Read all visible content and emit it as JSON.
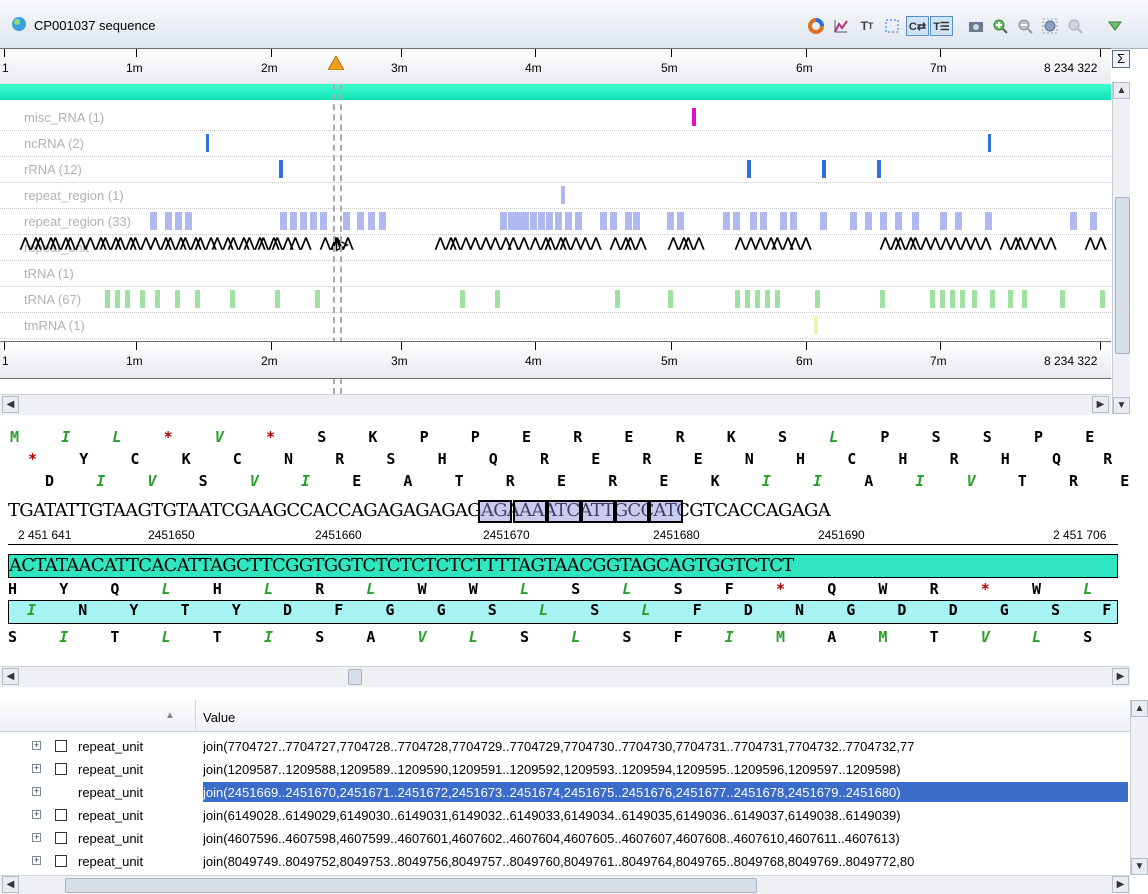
{
  "window": {
    "title": "CP001037 sequence"
  },
  "toolbar": {
    "icons": [
      "color-wheel-icon",
      "chart-icon",
      "font-size-icon",
      "select-region-icon",
      "sync-icon",
      "text-toggle-icon",
      "camera-icon",
      "zoom-in-icon",
      "zoom-out-icon",
      "zoom-fit-icon",
      "zoom-reset-icon",
      "dropdown-icon"
    ]
  },
  "ruler": {
    "ticks": [
      "1",
      "1m",
      "2m",
      "3m",
      "4m",
      "5m",
      "6m",
      "7m",
      "8 234 322"
    ]
  },
  "tracks": [
    {
      "label": "misc_RNA (1)"
    },
    {
      "label": "ncRNA (2)"
    },
    {
      "label": "rRNA (12)"
    },
    {
      "label": "repeat_region (1)"
    },
    {
      "label": "repeat_region (33)"
    },
    {
      "label": "repeat_unit"
    },
    {
      "label": "tRNA (1)"
    },
    {
      "label": "tRNA (67)"
    },
    {
      "label": "tmRNA (1)"
    }
  ],
  "colors": {
    "accent_cyan": "#10e0b8",
    "selection_blue": "#3b6cc9",
    "misc_rna": "#e010c0",
    "rrna": "#3070e0",
    "repeat": "#b0b8f0",
    "trna": "#a0e0a0"
  },
  "sequence": {
    "frame1": [
      "M",
      "I",
      "L",
      "*",
      "V",
      "*",
      "S",
      "K",
      "P",
      "P",
      "E",
      "R",
      "E",
      "R",
      "K",
      "S",
      "L",
      "P",
      "S",
      "S",
      "P",
      "E"
    ],
    "frame2": [
      "*",
      "Y",
      "C",
      "K",
      "C",
      "N",
      "R",
      "S",
      "H",
      "Q",
      "R",
      "E",
      "R",
      "E",
      "N",
      "H",
      "C",
      "H",
      "R",
      "H",
      "Q",
      "R"
    ],
    "frame3": [
      "D",
      "I",
      "V",
      "S",
      "V",
      "I",
      "E",
      "A",
      "T",
      "R",
      "E",
      "R",
      "E",
      "K",
      "I",
      "I",
      "A",
      "I",
      "V",
      "T",
      "R",
      "E"
    ],
    "dna_top": "TGATATTGTAAGTGTAATCGAAGCCACCAGAGAGAGAGAGAAAATCATTGCCATCGTCACCAGAGA",
    "positions": [
      "2 451 641",
      "2451650",
      "2451660",
      "2451670",
      "2451680",
      "2451690",
      "2 451 706"
    ],
    "dna_bottom": "ACTATAACATTCACATTAGCTTCGGTGGTCTCTCTCTCTTTTAGTAACGGTAGCAGTGGTCTCT",
    "rframe1": [
      "H",
      "Y",
      "Q",
      "L",
      "H",
      "L",
      "R",
      "L",
      "W",
      "W",
      "L",
      "S",
      "L",
      "S",
      "F",
      "*",
      "Q",
      "W",
      "R",
      "*",
      "W",
      "L"
    ],
    "rframe2": [
      "I",
      "N",
      "Y",
      "T",
      "Y",
      "D",
      "F",
      "G",
      "G",
      "S",
      "L",
      "S",
      "L",
      "F",
      "D",
      "N",
      "G",
      "D",
      "D",
      "G",
      "S",
      "F"
    ],
    "rframe3": [
      "S",
      "I",
      "T",
      "L",
      "T",
      "I",
      "S",
      "A",
      "V",
      "L",
      "S",
      "L",
      "S",
      "F",
      "I",
      "M",
      "A",
      "M",
      "T",
      "V",
      "L",
      "S"
    ]
  },
  "table": {
    "header_value": "Value",
    "rows": [
      {
        "name": "repeat_unit",
        "value": "join(7704727..7704727,7704728..7704728,7704729..7704729,7704730..7704730,7704731..7704731,7704732..7704732,77"
      },
      {
        "name": "repeat_unit",
        "value": "join(1209587..1209588,1209589..1209590,1209591..1209592,1209593..1209594,1209595..1209596,1209597..1209598)"
      },
      {
        "name": "repeat_unit",
        "value": "join(2451669..2451670,2451671..2451672,2451673..2451674,2451675..2451676,2451677..2451678,2451679..2451680)",
        "selected": true
      },
      {
        "name": "repeat_unit",
        "value": "join(6149028..6149029,6149030..6149031,6149032..6149033,6149034..6149035,6149036..6149037,6149038..6149039)"
      },
      {
        "name": "repeat_unit",
        "value": "join(4607596..4607598,4607599..4607601,4607602..4607604,4607605..4607607,4607608..4607610,4607611..4607613)"
      },
      {
        "name": "repeat_unit",
        "value": "join(8049749..8049752,8049753..8049756,8049757..8049760,8049761..8049764,8049765..8049768,8049769..8049772,80"
      }
    ]
  }
}
